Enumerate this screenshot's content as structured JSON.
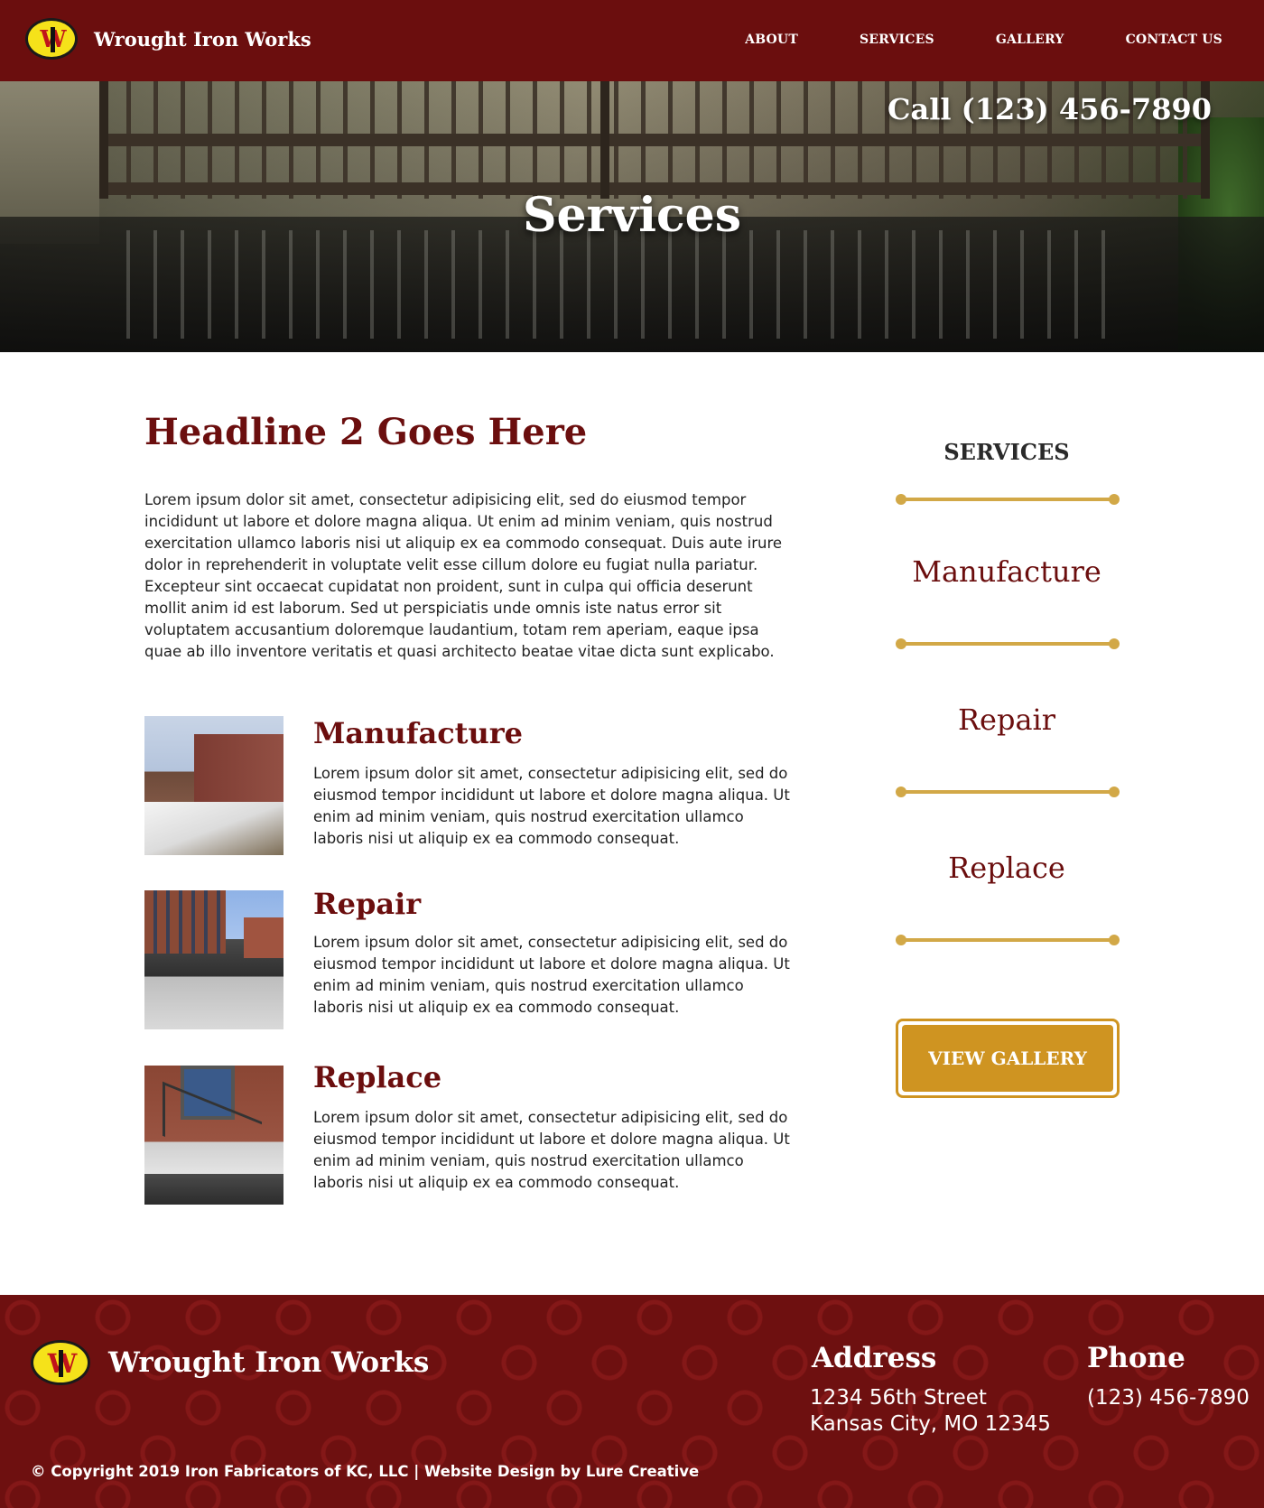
{
  "brand": {
    "name": "Wrought Iron Works",
    "logo_letters": "W",
    "colors": {
      "primary": "#6b0e0e",
      "accent": "#cf9421",
      "divider": "#d2a847"
    }
  },
  "nav": {
    "items": [
      "ABOUT",
      "SERVICES",
      "GALLERY",
      "CONTACT US"
    ]
  },
  "hero": {
    "call": "Call (123) 456-7890",
    "title": "Services"
  },
  "main": {
    "headline": "Headline 2 Goes Here",
    "intro": "Lorem ipsum dolor sit amet, consectetur adipisicing elit, sed do eiusmod tempor incididunt ut labore et dolore magna aliqua. Ut enim ad minim veniam, quis nostrud exercitation ullamco laboris nisi ut aliquip ex ea commodo consequat. Duis aute irure dolor in reprehenderit in voluptate velit esse cillum dolore eu fugiat nulla pariatur. Excepteur sint occaecat cupidatat non proident, sunt in culpa qui officia deserunt mollit anim id est laborum. Sed ut perspiciatis unde omnis iste natus error sit voluptatem accusantium doloremque laudantium, totam rem aperiam, eaque ipsa quae ab illo inventore veritatis et quasi architecto beatae vitae dicta sunt explicabo.",
    "services": [
      {
        "title": "Manufacture",
        "desc": "Lorem ipsum dolor sit amet, consectetur adipisicing elit, sed do eiusmod tempor incididunt ut labore et dolore magna aliqua. Ut enim ad minim veniam, quis nostrud exercitation ullamco laboris nisi ut aliquip ex ea commodo consequat."
      },
      {
        "title": "Repair",
        "desc": "Lorem ipsum dolor sit amet, consectetur adipisicing elit, sed do eiusmod tempor incididunt ut labore et dolore magna aliqua. Ut enim ad minim veniam, quis nostrud exercitation ullamco laboris nisi ut aliquip ex ea commodo consequat."
      },
      {
        "title": "Replace",
        "desc": "Lorem ipsum dolor sit amet, consectetur adipisicing elit, sed do eiusmod tempor incididunt ut labore et dolore magna aliqua. Ut enim ad minim veniam, quis nostrud exercitation ullamco laboris nisi ut aliquip ex ea commodo consequat."
      }
    ]
  },
  "sidebar": {
    "title": "SERVICES",
    "items": [
      "Manufacture",
      "Repair",
      "Replace"
    ],
    "button": "VIEW GALLERY"
  },
  "footer": {
    "brand": "Wrought Iron Works",
    "address_heading": "Address",
    "address_line1": "1234 56th Street",
    "address_line2": "Kansas City, MO 12345",
    "phone_heading": "Phone",
    "phone": "(123) 456-7890",
    "copyright": "© Copyright 2019 Iron Fabricators of KC, LLC | Website Design by Lure Creative"
  }
}
